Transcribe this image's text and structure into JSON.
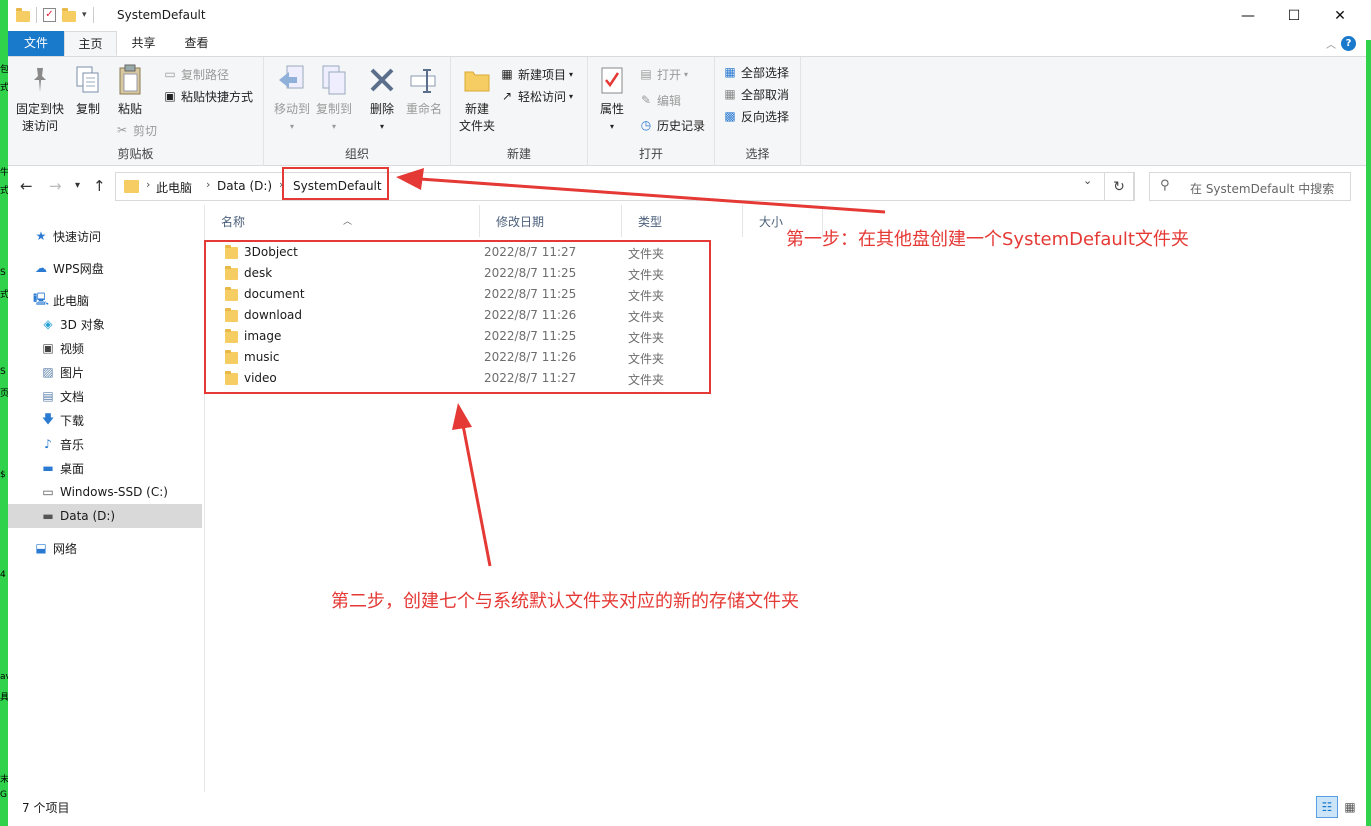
{
  "window": {
    "title": "SystemDefault",
    "controls": {
      "minimize": "—",
      "maximize": "☐",
      "close": "✕"
    }
  },
  "ribbon_tabs": [
    "文件",
    "主页",
    "共享",
    "查看"
  ],
  "ribbon": {
    "clipboard": {
      "label": "剪贴板",
      "pin": "固定到快速访问",
      "pin_line1": "固定到快",
      "pin_line2": "速访问",
      "copy": "复制",
      "paste": "粘贴",
      "copy_path": "复制路径",
      "paste_shortcut": "粘贴快捷方式",
      "cut": "剪切"
    },
    "organize": {
      "label": "组织",
      "move_to": "移动到",
      "copy_to": "复制到",
      "delete": "删除",
      "rename": "重命名"
    },
    "new": {
      "label": "新建",
      "new_folder_line1": "新建",
      "new_folder_line2": "文件夹",
      "new_item": "新建项目",
      "easy_access": "轻松访问"
    },
    "open": {
      "label": "打开",
      "properties": "属性",
      "open": "打开",
      "edit": "编辑",
      "history": "历史记录"
    },
    "select": {
      "label": "选择",
      "select_all": "全部选择",
      "select_none": "全部取消",
      "invert": "反向选择"
    }
  },
  "address": {
    "crumbs": [
      "此电脑",
      "Data (D:)",
      "SystemDefault"
    ],
    "search_placeholder": "在 SystemDefault 中搜索"
  },
  "nav": {
    "quick_access": "快速访问",
    "wps": "WPS网盘",
    "this_pc": "此电脑",
    "items": [
      {
        "label": "3D 对象",
        "icon": "cube-icon"
      },
      {
        "label": "视频",
        "icon": "video-icon"
      },
      {
        "label": "图片",
        "icon": "picture-icon"
      },
      {
        "label": "文档",
        "icon": "document-icon"
      },
      {
        "label": "下载",
        "icon": "download-icon"
      },
      {
        "label": "音乐",
        "icon": "music-icon"
      },
      {
        "label": "桌面",
        "icon": "desktop-icon"
      },
      {
        "label": "Windows-SSD (C:)",
        "icon": "drive-icon"
      },
      {
        "label": "Data (D:)",
        "icon": "drive-icon"
      }
    ],
    "network": "网络"
  },
  "columns": {
    "name": "名称",
    "modified": "修改日期",
    "type": "类型",
    "size": "大小"
  },
  "files": [
    {
      "name": "3Dobject",
      "date": "2022/8/7 11:27",
      "type": "文件夹"
    },
    {
      "name": "desk",
      "date": "2022/8/7 11:25",
      "type": "文件夹"
    },
    {
      "name": "document",
      "date": "2022/8/7 11:25",
      "type": "文件夹"
    },
    {
      "name": "download",
      "date": "2022/8/7 11:26",
      "type": "文件夹"
    },
    {
      "name": "image",
      "date": "2022/8/7 11:25",
      "type": "文件夹"
    },
    {
      "name": "music",
      "date": "2022/8/7 11:26",
      "type": "文件夹"
    },
    {
      "name": "video",
      "date": "2022/8/7 11:27",
      "type": "文件夹"
    }
  ],
  "status": {
    "count": "7 个项目"
  },
  "annotations": {
    "step1": "第一步：在其他盘创建一个SystemDefault文件夹",
    "step2": "第二步，创建七个与系统默认文件夹对应的新的存储文件夹"
  },
  "colors": {
    "accent": "#1979ca",
    "annotation": "#e53935",
    "desktop": "#2fd24a",
    "folder": "#f5cd63"
  }
}
